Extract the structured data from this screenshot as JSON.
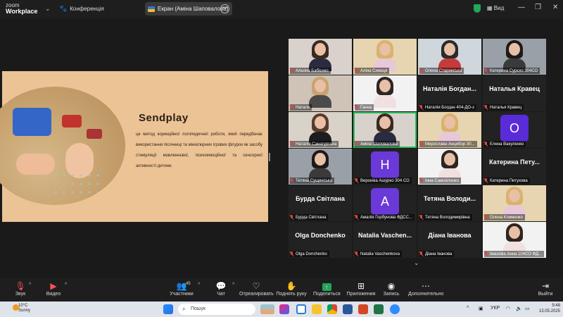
{
  "topbar": {
    "logo_line1": "zoom",
    "logo_line2": "Workplace",
    "conference": "Конференція",
    "share_label": "Екран (Аміна Шаповалова)",
    "view": "Вид"
  },
  "slide": {
    "title": "Sendplay",
    "text": "це метод корекційної логопедичної роботи, який передбачає використання пісочниці та мініатюрних ігрових фігурок як засобу стимуляції мовленнєвої, психоемоційної та сенсорної активності дитини."
  },
  "participants": [
    {
      "name": "Альона Бабієнко",
      "kind": "photo"
    },
    {
      "name": "Аліна Синиця",
      "kind": "photo"
    },
    {
      "name": "Олена Старинська",
      "kind": "photo"
    },
    {
      "name": "Катерина Сурєхо 304СО",
      "kind": "photo"
    },
    {
      "name": "Наталя",
      "kind": "photo"
    },
    {
      "name": "Ганна",
      "kind": "photo"
    },
    {
      "name": "Наталія Богдан 404-ДО-з",
      "kind": "text",
      "big": "Наталія Богдан..."
    },
    {
      "name": "Наталья Кравец",
      "kind": "text",
      "big": "Наталья Кравец"
    },
    {
      "name": "Наталія Санагурська",
      "kind": "photo"
    },
    {
      "name": "Аміна Шаповалова",
      "kind": "photo"
    },
    {
      "name": "Мирослава Анцибор 30...",
      "kind": "photo"
    },
    {
      "name": "Елена Вакуленко",
      "kind": "avatar",
      "letter": "O",
      "color": "#5a2bd8"
    },
    {
      "name": "Тетяна Сущинська",
      "kind": "photo"
    },
    {
      "name": "Вероніка Ашурко 304 СО",
      "kind": "avatar",
      "letter": "H",
      "color": "#6b39d8"
    },
    {
      "name": "Інна Самойленко",
      "kind": "photo"
    },
    {
      "name": "Катерина Петухова",
      "kind": "text",
      "big": "Катерина Пету..."
    },
    {
      "name": "Бурда Світлана",
      "kind": "text",
      "big": "Бурда Світлана"
    },
    {
      "name": "Амалія Горбунова ФДСС...",
      "kind": "avatar",
      "letter": "A",
      "color": "#6b39d8"
    },
    {
      "name": "Тетяна Володимирівна",
      "kind": "text",
      "big": "Тетяна Володи..."
    },
    {
      "name": "Олена Клименко",
      "kind": "photo"
    },
    {
      "name": "Olga Donchenko",
      "kind": "text",
      "big": "Olga Donchenko"
    },
    {
      "name": "Natalia Vaschenkova",
      "kind": "text",
      "big": "Natalia Vaschen..."
    },
    {
      "name": "Діана Іванова",
      "kind": "text",
      "big": "Діана Іванова"
    },
    {
      "name": "Івашова Анна 104СО ФД...",
      "kind": "photo"
    }
  ],
  "toolbar": {
    "audio": "Звук",
    "video": "Видео",
    "participants": "Участники",
    "participants_count": "45",
    "chat": "Чат",
    "react": "Отреагировать",
    "raise_hand": "Поднять руку",
    "share": "Поделиться",
    "apps": "Приложения",
    "record": "Запись",
    "more": "Дополнительно",
    "leave": "Выйти"
  },
  "taskbar": {
    "temp": "10°C",
    "weather": "Sunny",
    "search": "Пошук",
    "lang": "УКР",
    "time": "9:48",
    "date": "13.05.2025"
  },
  "colors": {
    "active_speaker": "#25c05a",
    "slide_bg": "#ecc395",
    "muted": "#e04444"
  }
}
